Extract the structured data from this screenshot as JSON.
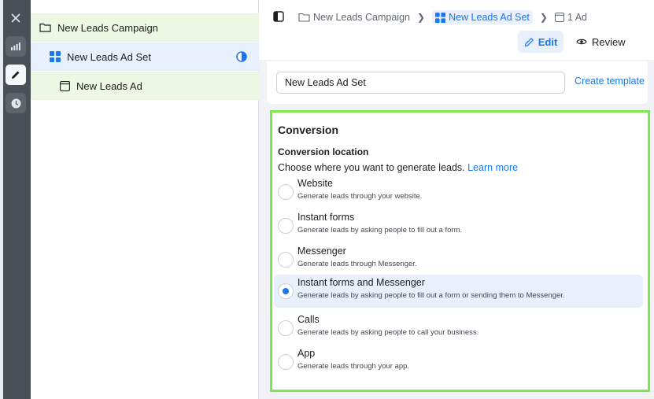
{
  "rail": {
    "icons": [
      "close-icon",
      "stats-icon",
      "pencil-icon",
      "clock-icon"
    ]
  },
  "tree": {
    "campaign": "New Leads Campaign",
    "adset": "New Leads Ad Set",
    "ad": "New Leads Ad"
  },
  "breadcrumb": {
    "campaign": "New Leads Campaign",
    "adset": "New Leads Ad Set",
    "ad": "1 Ad"
  },
  "toolbar": {
    "edit_label": "Edit",
    "review_label": "Review"
  },
  "name_card": {
    "value": "New Leads Ad Set",
    "create_template": "Create template"
  },
  "conversion": {
    "title": "Conversion",
    "location_label": "Conversion location",
    "location_sub": "Choose where you want to generate leads.",
    "learn_more": "Learn more",
    "options": [
      {
        "title": "Website",
        "desc": "Generate leads through your website.",
        "selected": false
      },
      {
        "title": "Instant forms",
        "desc": "Generate leads by asking people to fill out a form.",
        "selected": false
      },
      {
        "title": "Messenger",
        "desc": "Generate leads through Messenger.",
        "selected": false
      },
      {
        "title": "Instant forms and Messenger",
        "desc": "Generate leads by asking people to fill out a form or sending them to Messenger.",
        "selected": true
      },
      {
        "title": "Calls",
        "desc": "Generate leads by asking people to call your business.",
        "selected": false
      },
      {
        "title": "App",
        "desc": "Generate leads through your app.",
        "selected": false
      }
    ]
  },
  "colors": {
    "accent": "#1877f2",
    "highlight_border": "#7fe84c",
    "rail": "#4b4f56"
  }
}
